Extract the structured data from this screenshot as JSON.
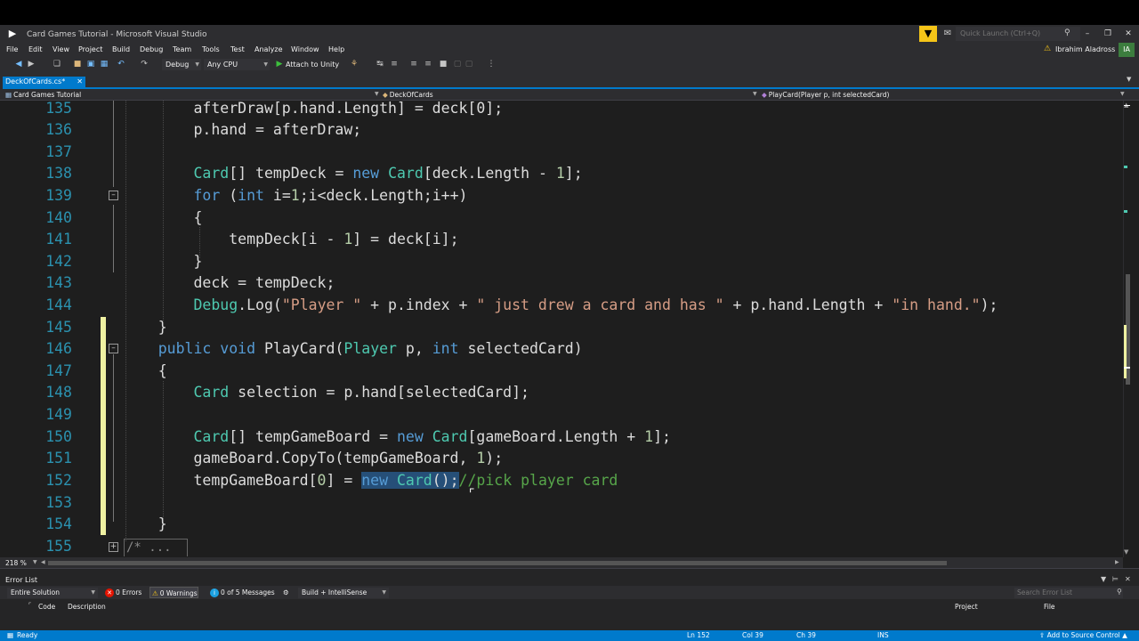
{
  "window": {
    "title": "Card Games Tutorial - Microsoft Visual Studio",
    "quick_launch_placeholder": "Quick Launch (Ctrl+Q)",
    "user": "Ibrahim Aladross",
    "user_initials": "IA"
  },
  "menu": [
    "File",
    "Edit",
    "View",
    "Project",
    "Build",
    "Debug",
    "Team",
    "Tools",
    "Test",
    "Analyze",
    "Window",
    "Help"
  ],
  "toolbar": {
    "config": "Debug",
    "platform": "Any CPU",
    "attach": "Attach to Unity"
  },
  "document_tab": {
    "label": "DeckOfCards.cs*"
  },
  "navbar": {
    "project": "Card Games Tutorial",
    "class": "DeckOfCards",
    "member": "PlayCard(Player p, int selectedCard)"
  },
  "editor": {
    "lines": [
      {
        "num": "135",
        "text": "        afterDraw[p.hand.Length] = deck[0];"
      },
      {
        "num": "136",
        "text": "        p.hand = afterDraw;"
      },
      {
        "num": "137",
        "text": ""
      },
      {
        "num": "138",
        "text": "        Card[] tempDeck = new Card[deck.Length - 1];"
      },
      {
        "num": "139",
        "text": "        for (int i=1;i<deck.Length;i++)"
      },
      {
        "num": "140",
        "text": "        {"
      },
      {
        "num": "141",
        "text": "            tempDeck[i - 1] = deck[i];"
      },
      {
        "num": "142",
        "text": "        }"
      },
      {
        "num": "143",
        "text": "        deck = tempDeck;"
      },
      {
        "num": "144",
        "text": "        Debug.Log(\"Player \" + p.index + \" just drew a card and has \" + p.hand.Length + \"in hand.\");"
      },
      {
        "num": "145",
        "text": "    }"
      },
      {
        "num": "146",
        "text": "    public void PlayCard(Player p, int selectedCard)"
      },
      {
        "num": "147",
        "text": "    {"
      },
      {
        "num": "148",
        "text": "        Card selection = p.hand[selectedCard];"
      },
      {
        "num": "149",
        "text": ""
      },
      {
        "num": "150",
        "text": "        Card[] tempGameBoard = new Card[gameBoard.Length + 1];"
      },
      {
        "num": "151",
        "text": "        gameBoard.CopyTo(tempGameBoard, 1);"
      },
      {
        "num": "152",
        "text": "        tempGameBoard[0] = new Card();//pick player card"
      },
      {
        "num": "153",
        "text": ""
      },
      {
        "num": "154",
        "text": "    }"
      },
      {
        "num": "155",
        "text": "/* ..."
      }
    ],
    "collapsed_text": "/* ..."
  },
  "zoom": "218 %",
  "error_list": {
    "title": "Error List",
    "scope": "Entire Solution",
    "errors": "0 Errors",
    "warnings": "0 Warnings",
    "messages": "0 of 5 Messages",
    "build_filter": "Build + IntelliSense",
    "search_placeholder": "Search Error List",
    "columns": {
      "code": "Code",
      "description": "Description",
      "project": "Project",
      "file": "File"
    }
  },
  "status": {
    "ready": "Ready",
    "ln": "Ln 152",
    "col": "Col 39",
    "ch": "Ch 39",
    "ins": "INS",
    "source_control": "Add to Source Control"
  },
  "colors": {
    "accent": "#007acc",
    "keyword": "#569cd6",
    "type": "#4ec9b0",
    "string": "#d69d85",
    "comment": "#57a64a",
    "line_number": "#2b91af",
    "change_bar": "#eff1a2"
  }
}
